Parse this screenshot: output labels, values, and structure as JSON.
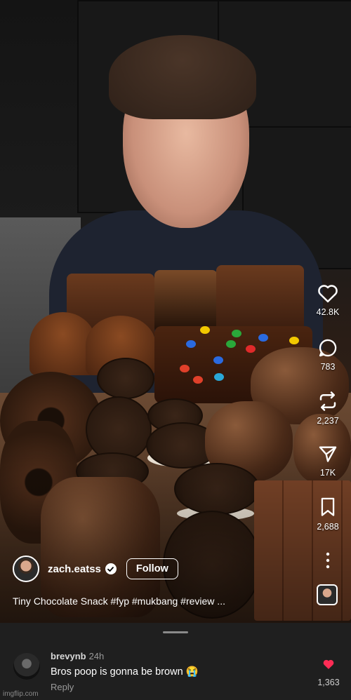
{
  "actions": {
    "likes": "42.8K",
    "comments": "783",
    "reposts": "2,237",
    "shares": "17K",
    "saves": "2,688"
  },
  "post": {
    "username": "zach.eatss",
    "follow_label": "Follow",
    "caption": "Tiny Chocolate Snack #fyp #mukbang #review ..."
  },
  "comment": {
    "username": "brevynb",
    "time": "24h",
    "text": "Bros poop is gonna be brown 😭",
    "reply_label": "Reply",
    "likes": "1,363",
    "like_color": "#fe2c55"
  },
  "watermark": "imgflip.com",
  "icons": [
    "heart-icon",
    "comment-icon",
    "repost-icon",
    "share-icon",
    "bookmark-icon",
    "more-icon",
    "verified-icon",
    "music-disc"
  ]
}
